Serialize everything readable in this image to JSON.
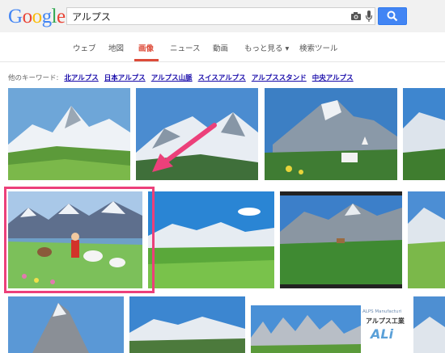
{
  "header": {
    "logo": [
      "G",
      "o",
      "o",
      "g",
      "l",
      "e"
    ],
    "logo_colors": [
      "#4285f4",
      "#ea4335",
      "#fbbc05",
      "#4285f4",
      "#34a853",
      "#ea4335"
    ],
    "search_value": "アルプス"
  },
  "tabs": [
    {
      "label": "ウェブ",
      "active": false
    },
    {
      "label": "地図",
      "active": false
    },
    {
      "label": "画像",
      "active": true
    },
    {
      "label": "ニュース",
      "active": false
    },
    {
      "label": "動画",
      "active": false
    },
    {
      "label": "もっと見る ▾",
      "active": false
    },
    {
      "label": "検索ツール",
      "active": false
    }
  ],
  "related": {
    "label": "他のキーワード:",
    "keywords": [
      "北アルプス",
      "日本アルプス",
      "アルプス山脈",
      "スイスアルプス",
      "アルプススタンド",
      "中央アルプス"
    ]
  },
  "overlay_logo": {
    "small_text": "ALPS Manufacturi",
    "name": "アルプス工業",
    "mark": "ALi"
  },
  "colors": {
    "accent": "#dd4b39",
    "link": "#1a0dab",
    "highlight": "#ec407a",
    "search_button": "#4285f4"
  }
}
